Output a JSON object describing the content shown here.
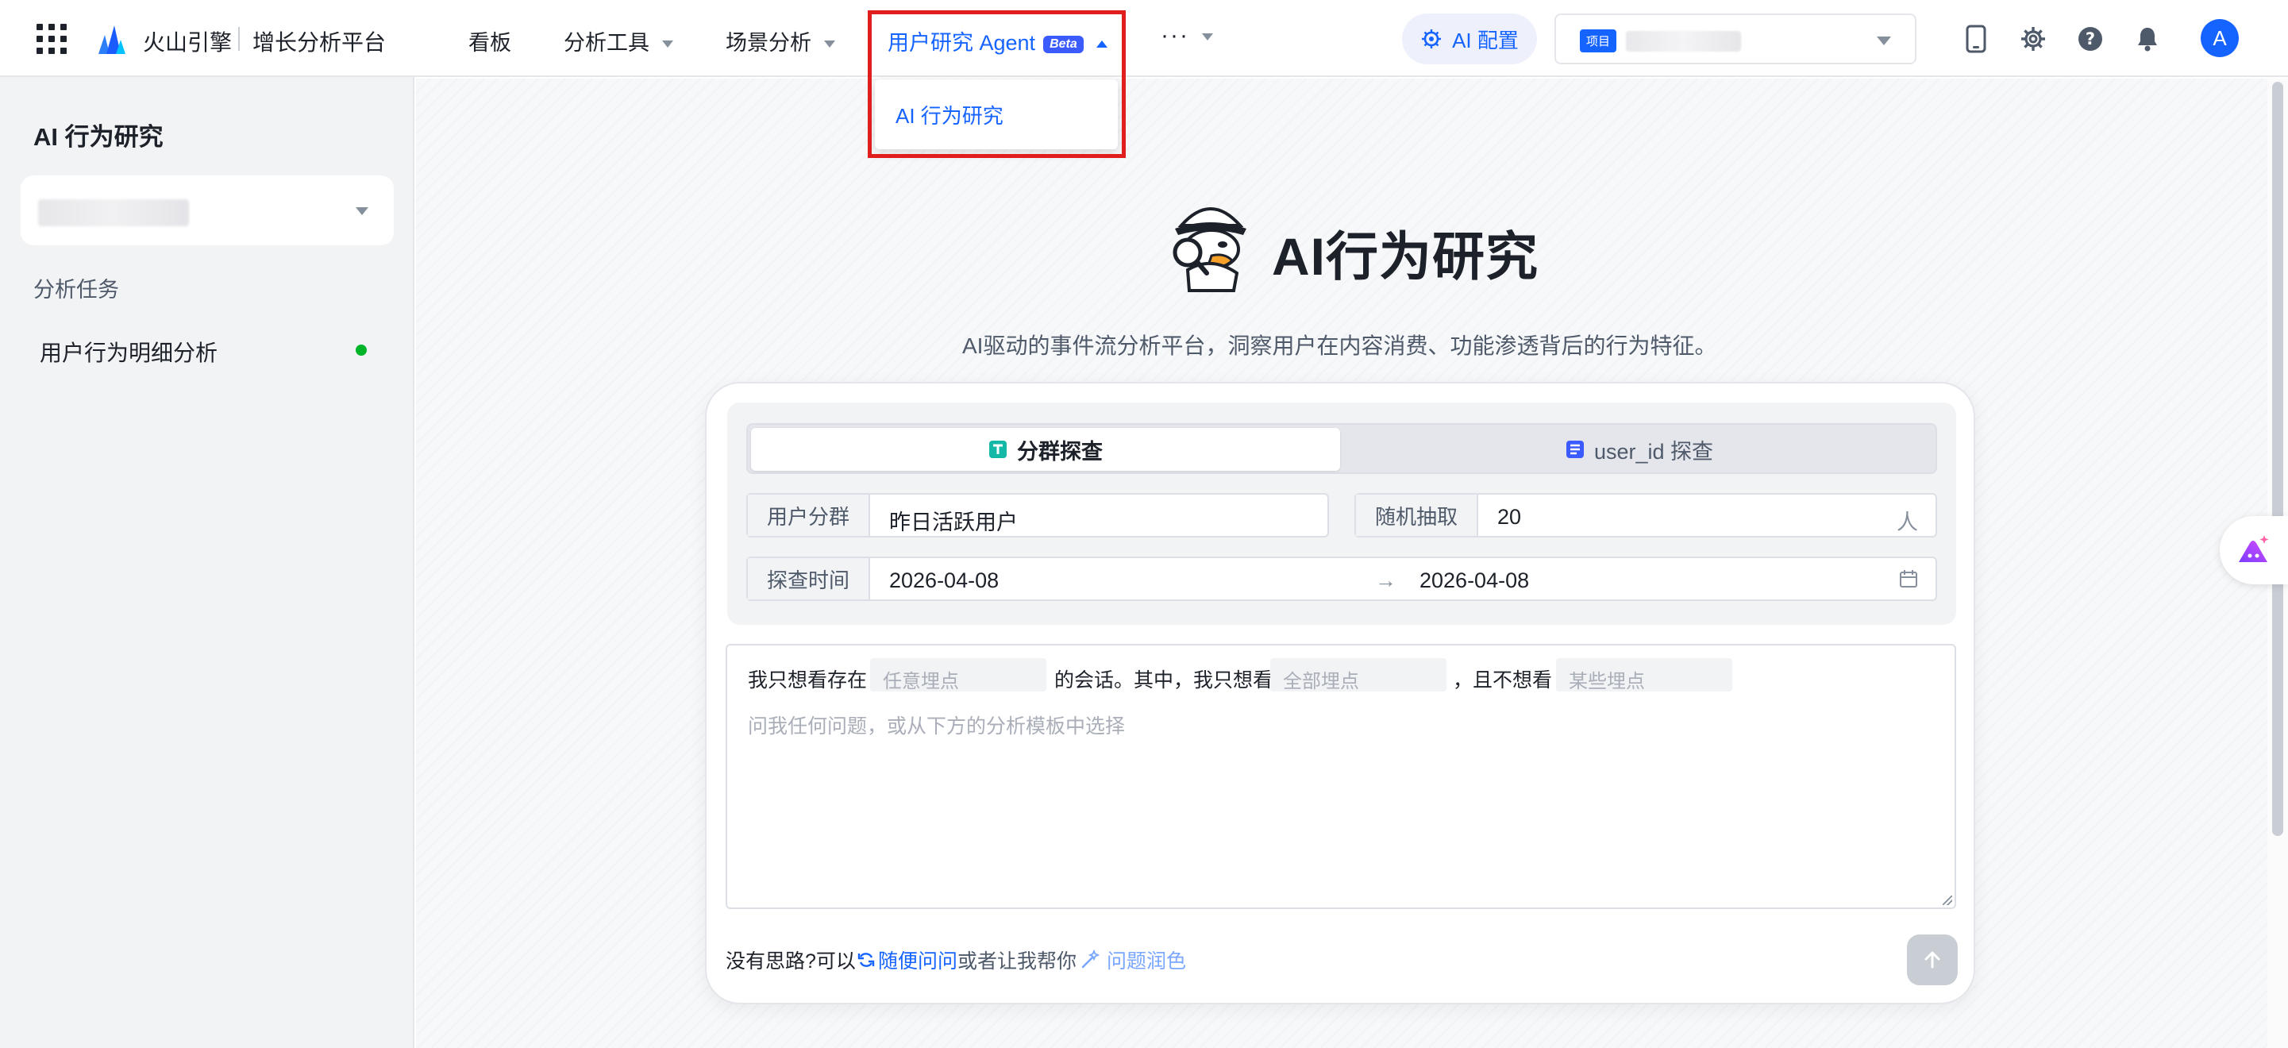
{
  "header": {
    "brand": "火山引擎",
    "platform": "增长分析平台",
    "nav": [
      {
        "label": "看板"
      },
      {
        "label": "分析工具"
      },
      {
        "label": "场景分析"
      },
      {
        "label": "用户研究 Agent",
        "badge": "Beta"
      },
      {
        "label": "···"
      }
    ],
    "dropdown_items": [
      "AI 行为研究"
    ],
    "ai_config_label": "AI 配置",
    "project_tag": "项目",
    "avatar_letter": "A",
    "icons": [
      "mobile-icon",
      "gear-icon",
      "help-icon",
      "bell-icon"
    ]
  },
  "sidebar": {
    "title": "AI 行为研究",
    "section_label": "分析任务",
    "tasks": [
      {
        "label": "用户行为明细分析",
        "status_color": "#00b42a"
      }
    ]
  },
  "main": {
    "title": "AI行为研究",
    "subtitle": "AI驱动的事件流分析平台，洞察用户在内容消费、功能渗透背后的行为特征。",
    "tabs": [
      {
        "label": "分群探查",
        "icon": "tag-icon",
        "active": true
      },
      {
        "label": "user_id 探查",
        "icon": "list-icon",
        "active": false
      }
    ],
    "form": {
      "segment_label": "用户分群",
      "segment_value": "昨日活跃用户",
      "sample_label": "随机抽取",
      "sample_value": "20",
      "sample_unit": "人",
      "time_label": "探查时间",
      "start_date": "2026-04-08",
      "end_date": "2026-04-08",
      "arrow": "→"
    },
    "composer": {
      "text1": "我只想看存在",
      "slot1": "任意埋点",
      "text2": "的会话。其中，我只想看",
      "slot2": "全部埋点",
      "text3": "，且不想看",
      "slot3": "某些埋点",
      "placeholder": "问我任何问题，或从下方的分析模板中选择"
    },
    "footer": {
      "prefix": "没有思路?可以",
      "random_ask": "随便问问",
      "middle": "或者让我帮你",
      "polish": "问题润色"
    }
  },
  "colors": {
    "accent": "#1664ff",
    "highlight": "#e01e1e",
    "status_ok": "#00b42a"
  }
}
